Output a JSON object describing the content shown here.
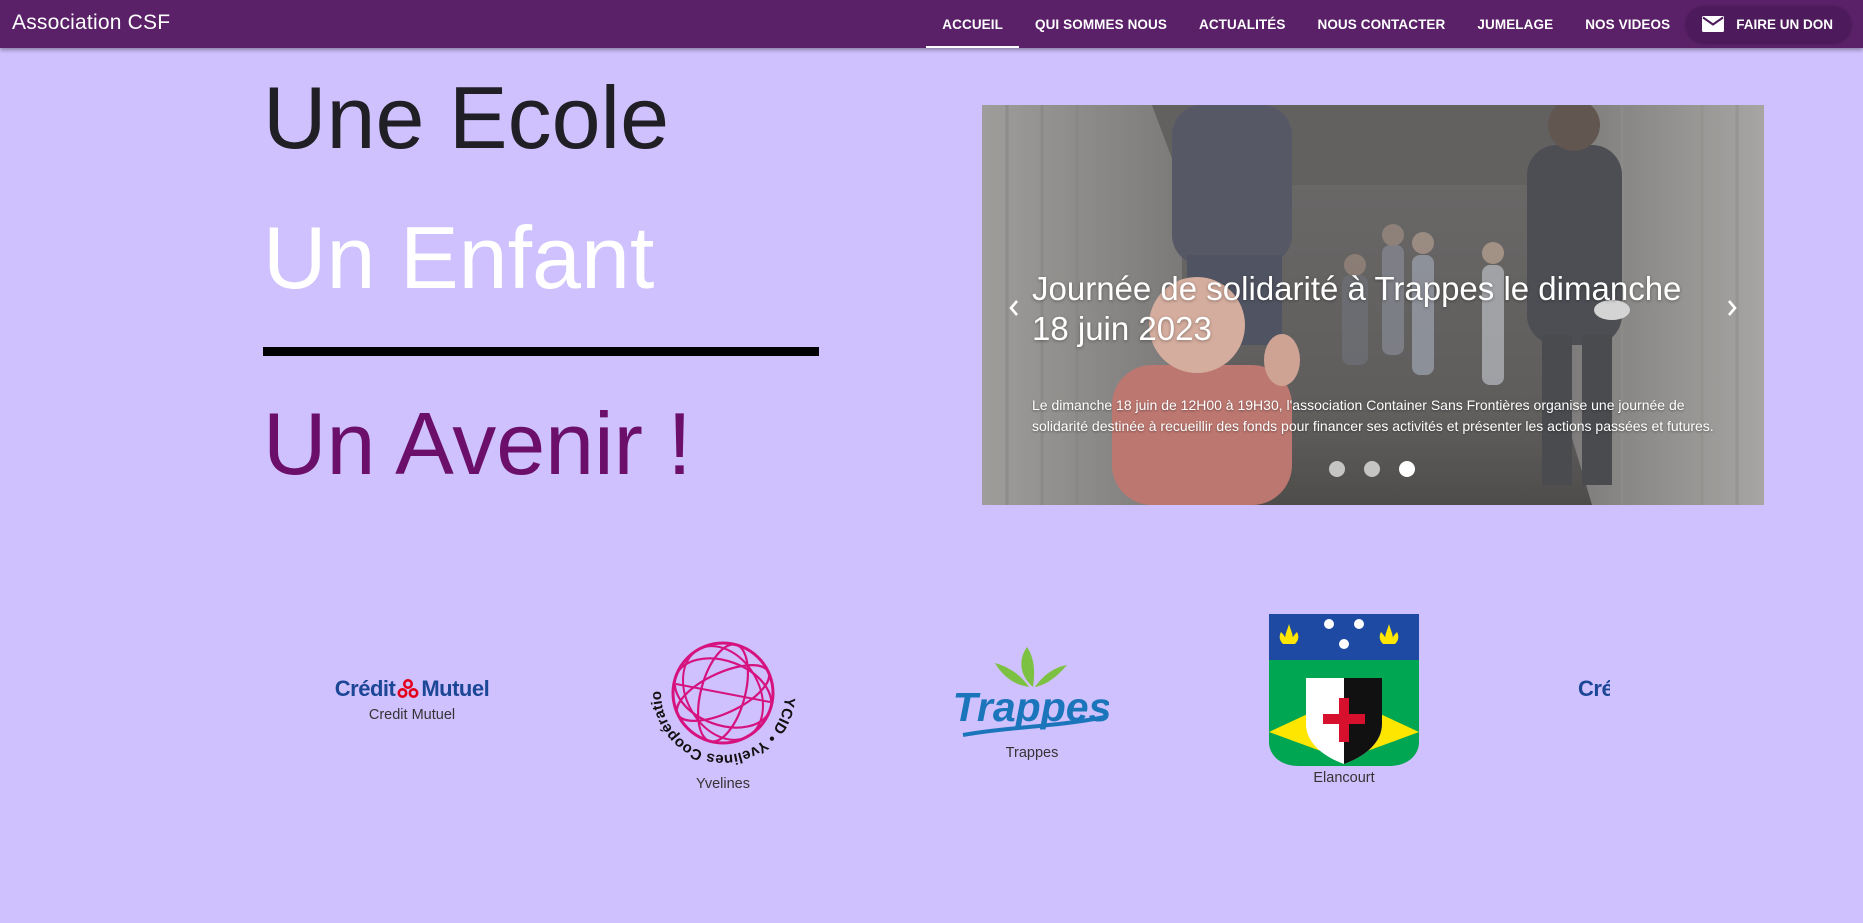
{
  "brand": "Association CSF",
  "nav": {
    "items": [
      {
        "label": "ACCUEIL",
        "active": true
      },
      {
        "label": "QUI SOMMES NOUS",
        "active": false
      },
      {
        "label": "ACTUALITÉS",
        "active": false
      },
      {
        "label": "NOUS CONTACTER",
        "active": false
      },
      {
        "label": "JUMELAGE",
        "active": false
      },
      {
        "label": "NOS VIDEOS",
        "active": false
      }
    ],
    "donate": {
      "label": "FAIRE UN DON",
      "icon": "mail-icon"
    }
  },
  "hero": {
    "line1": "Une Ecole",
    "line2": "Un Enfant",
    "line3": "Un Avenir !"
  },
  "carousel": {
    "title": "Journée de solidarité à Trappes le dimanche 18 juin 2023",
    "text": "Le dimanche 18 juin de 12H00 à 19H30, l'association Container Sans Frontières organise une journée de solidarité destinée à recueillir des fonds pour financer ses activités et présenter les actions passées et futures.",
    "slides": 3,
    "active_slide": 3,
    "prev_icon": "chevron-left-icon",
    "next_icon": "chevron-right-icon"
  },
  "partners": [
    {
      "caption": "Credit Mutuel",
      "logo_text_1": "Crédit",
      "logo_text_2": "Mutuel"
    },
    {
      "caption": "Yvelines",
      "logo_ring_text": "YCID • Yvelines Coopération internationale & développement"
    },
    {
      "caption": "Trappes",
      "logo_text": "Trappes"
    },
    {
      "caption": "Elancourt"
    },
    {
      "logo_text_partial": "Cré"
    }
  ],
  "colors": {
    "background": "#cfc1fd",
    "topbar": "#5a2168",
    "hero_line1": "#211f26",
    "hero_line2": "#ffffff",
    "hero_line3": "#6b0f6b",
    "credit_mutuel_blue": "#1c4696",
    "credit_mutuel_red": "#e2001a",
    "ycid_pink": "#d6127f",
    "trappes_blue": "#1b75bb",
    "trappes_green": "#7dc142"
  }
}
